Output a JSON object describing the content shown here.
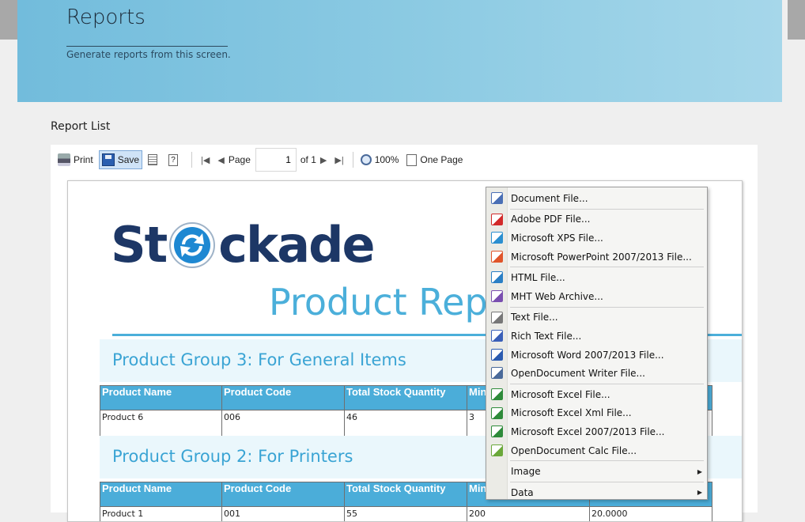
{
  "header": {
    "title": "Reports",
    "subtitle": "Generate reports from this screen."
  },
  "section": {
    "label": "Report List"
  },
  "toolbar": {
    "print_label": "Print",
    "save_label": "Save",
    "page_label": "Page",
    "page_value": "1",
    "of_label": "of 1",
    "zoom_label": "100%",
    "one_page_label": "One Page"
  },
  "report": {
    "logo_prefix": "St",
    "logo_suffix": "ckade",
    "title": "Product Rep",
    "groups": [
      {
        "title": "Product Group 3: For General Items",
        "headers": [
          "Product Name",
          "Product Code",
          "Total Stock Quantity",
          "Min"
        ],
        "rows": [
          [
            "Product 6",
            "006",
            "46",
            "3",
            ""
          ]
        ]
      },
      {
        "title": "Product Group 2: For Printers",
        "headers": [
          "Product Name",
          "Product Code",
          "Total Stock Quantity",
          "Min"
        ],
        "rows": [
          [
            "Product 1",
            "001",
            "55",
            "200",
            "20.0000"
          ]
        ]
      }
    ]
  },
  "save_menu": {
    "items": [
      {
        "label": "Document File...",
        "icon": "document-file-icon",
        "color": "#4a6fb5",
        "sep_after": true
      },
      {
        "label": "Adobe PDF File...",
        "icon": "pdf-file-icon",
        "color": "#d22a2a"
      },
      {
        "label": "Microsoft XPS File...",
        "icon": "xps-file-icon",
        "color": "#2b8fd0"
      },
      {
        "label": "Microsoft PowerPoint 2007/2013 File...",
        "icon": "powerpoint-file-icon",
        "color": "#e0552a",
        "sep_after": true
      },
      {
        "label": "HTML File...",
        "icon": "html-file-icon",
        "color": "#2a7fc5"
      },
      {
        "label": "MHT Web Archive...",
        "icon": "mht-archive-icon",
        "color": "#7a4fb0",
        "sep_after": true
      },
      {
        "label": "Text File...",
        "icon": "text-file-icon",
        "color": "#777777"
      },
      {
        "label": "Rich Text File...",
        "icon": "rich-text-file-icon",
        "color": "#3a5fb8"
      },
      {
        "label": "Microsoft Word 2007/2013 File...",
        "icon": "word-file-icon",
        "color": "#2b5bb0"
      },
      {
        "label": "OpenDocument Writer File...",
        "icon": "odt-file-icon",
        "color": "#4a6a9a",
        "sep_after": true
      },
      {
        "label": "Microsoft Excel File...",
        "icon": "excel-file-icon",
        "color": "#2e8b3a"
      },
      {
        "label": "Microsoft Excel Xml File...",
        "icon": "excel-xml-file-icon",
        "color": "#2e8b3a"
      },
      {
        "label": "Microsoft Excel 2007/2013 File...",
        "icon": "excel-2007-file-icon",
        "color": "#2e8b3a"
      },
      {
        "label": "OpenDocument Calc File...",
        "icon": "ods-file-icon",
        "color": "#6aa83a",
        "sep_after": true
      },
      {
        "label": "Image",
        "icon": "",
        "submenu": true,
        "sep_after": true
      },
      {
        "label": "Data",
        "icon": "",
        "submenu": true
      }
    ]
  },
  "colors": {
    "accent": "#4bafda",
    "header_bg": "#8dcbe3",
    "logo": "#1d3766"
  }
}
